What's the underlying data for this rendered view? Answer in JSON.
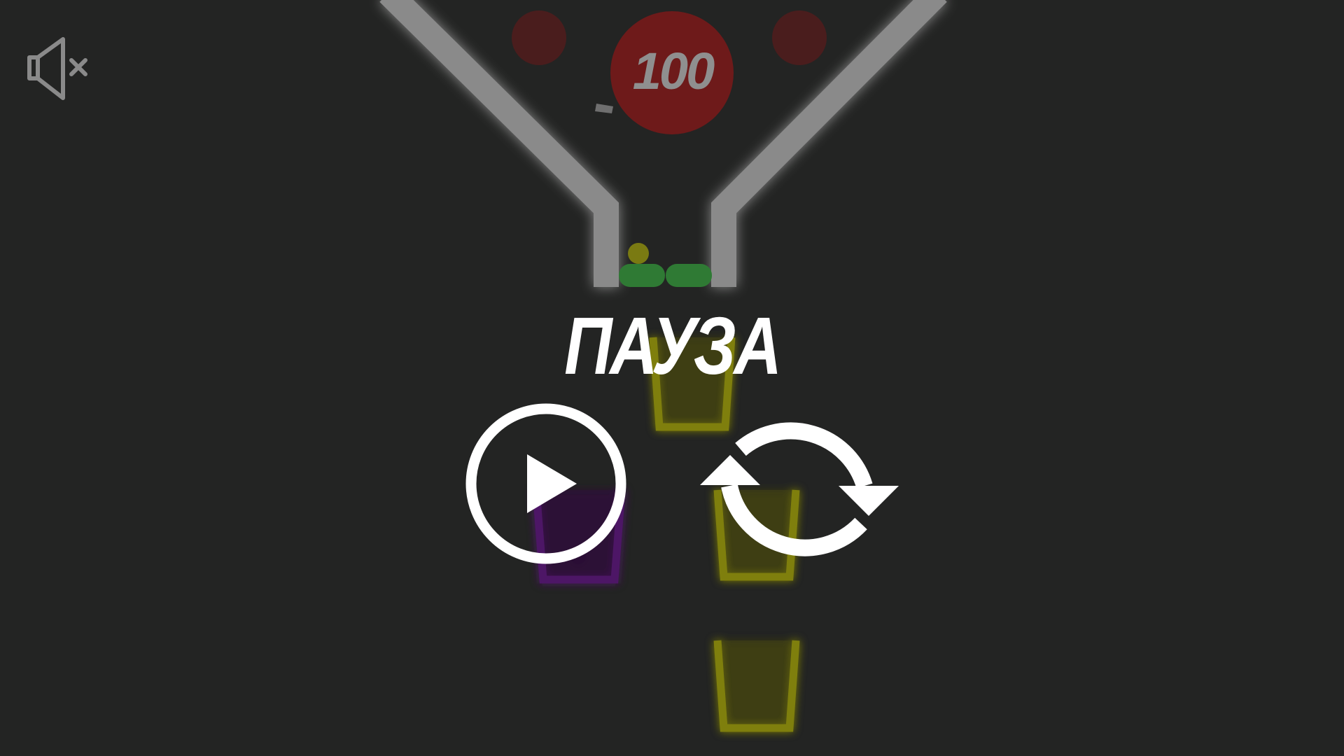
{
  "hud": {
    "sound_icon": "speaker-muted-icon",
    "score": "100"
  },
  "pause_menu": {
    "title": "ПАУЗА",
    "resume_icon": "play-icon",
    "restart_icon": "restart-icon"
  },
  "colors": {
    "background": "#232423",
    "funnel_wall": "#8a8a8a",
    "score_ball": "#6e1a1a",
    "score_ball_dim": "#4a1d1d",
    "gate_green": "#2f7a34",
    "ball_yellow": "#7a7a12",
    "cup_yellow": "#7f7f10",
    "cup_purple": "#4d1766",
    "overlay_text": "#ffffff",
    "score_text": "#8f8f8f"
  }
}
